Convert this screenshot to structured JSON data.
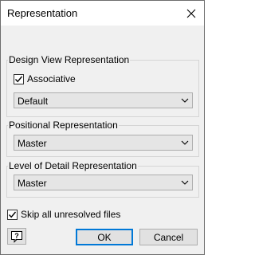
{
  "window": {
    "title": "Representation"
  },
  "design_view": {
    "group_label": "Design View Representation",
    "associative": {
      "label": "Associative",
      "checked": true
    },
    "select": {
      "value": "Default"
    }
  },
  "positional": {
    "group_label": "Positional Representation",
    "select": {
      "value": "Master"
    }
  },
  "level_of_detail": {
    "group_label": "Level of Detail Representation",
    "select": {
      "value": "Master"
    }
  },
  "skip_unresolved": {
    "label": "Skip all unresolved files",
    "checked": true
  },
  "buttons": {
    "help_icon": "help-icon",
    "ok": "OK",
    "cancel": "Cancel"
  }
}
